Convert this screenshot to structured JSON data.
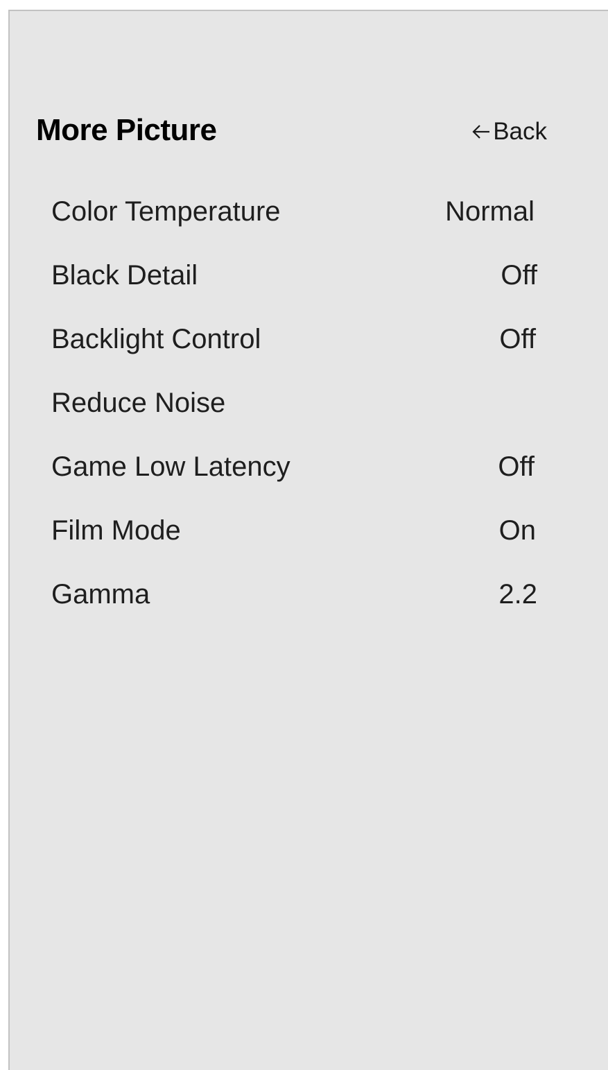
{
  "header": {
    "title": "More Picture",
    "back_label": "Back",
    "back_icon": "arrow-left-icon"
  },
  "menu": {
    "items": [
      {
        "label": "Color Temperature",
        "value": "Normal"
      },
      {
        "label": "Black Detail",
        "value": "Off"
      },
      {
        "label": "Backlight Control",
        "value": "Off"
      },
      {
        "label": "Reduce Noise",
        "value": ""
      },
      {
        "label": "Game Low Latency",
        "value": "Off"
      },
      {
        "label": "Film Mode",
        "value": "On"
      },
      {
        "label": "Gamma",
        "value": "2.2"
      }
    ]
  },
  "colors": {
    "panel_background": "#e6e6e6",
    "text": "#1e1e1e",
    "title": "#000000"
  }
}
